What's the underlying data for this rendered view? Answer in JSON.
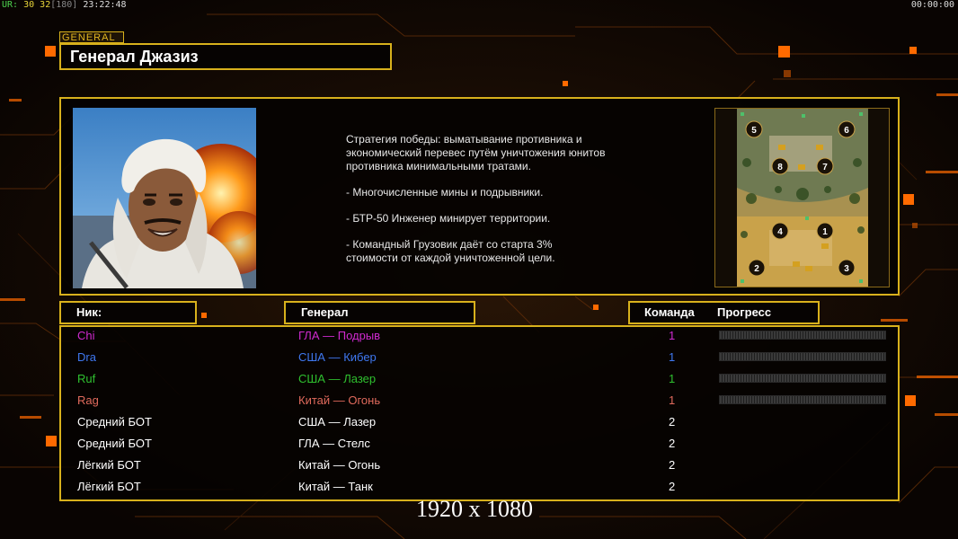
{
  "hud": {
    "label": "UR:",
    "val1": "30",
    "val2": "32",
    "val3": "[180]",
    "clock": "23:22:48",
    "timer": "00:00:00"
  },
  "general": {
    "tag": "GENERAL",
    "name": "Генерал Джазиз",
    "description": [
      "Стратегия победы: выматывание противника и\n экономический перевес путём уничтожения юнитов\n противника минимальными тратами.",
      "- Многочисленные мины и подрывники.",
      "- БТР-50 Инженер минирует территории.",
      "- Командный Грузовик даёт со старта 3%\n стоимости от каждой уничтоженной цели."
    ]
  },
  "map": {
    "spawns": [
      "5",
      "6",
      "8",
      "7",
      "4",
      "1",
      "2",
      "3"
    ]
  },
  "table": {
    "col_nick": "Ник:",
    "col_general": "Генерал",
    "col_team": "Команда",
    "col_progress": "Прогресс",
    "rows": [
      {
        "nick": "Chi",
        "general": "ГЛА — Подрыв",
        "team": "1",
        "color": "#d02ad0",
        "progress": 0
      },
      {
        "nick": "Dra",
        "general": "США — Кибер",
        "team": "1",
        "color": "#3f78f0",
        "progress": 0
      },
      {
        "nick": "Ruf",
        "general": "США — Лазер",
        "team": "1",
        "color": "#2fc02f",
        "progress": 0
      },
      {
        "nick": "Rag",
        "general": "Китай — Огонь",
        "team": "1",
        "color": "#e06a5c",
        "progress": 0
      },
      {
        "nick": "Средний БОТ",
        "general": "США — Лазер",
        "team": "2",
        "color": "#ffffff"
      },
      {
        "nick": "Средний БОТ",
        "general": "ГЛА — Стелс",
        "team": "2",
        "color": "#ffffff"
      },
      {
        "nick": "Лёгкий БОТ",
        "general": "Китай — Огонь",
        "team": "2",
        "color": "#ffffff"
      },
      {
        "nick": "Лёгкий БОТ",
        "general": "Китай — Танк",
        "team": "2",
        "color": "#ffffff"
      }
    ]
  },
  "resolution": "1920 x 1080",
  "colors": {
    "frame": "#d8b11c",
    "accent": "#ff6a00"
  }
}
